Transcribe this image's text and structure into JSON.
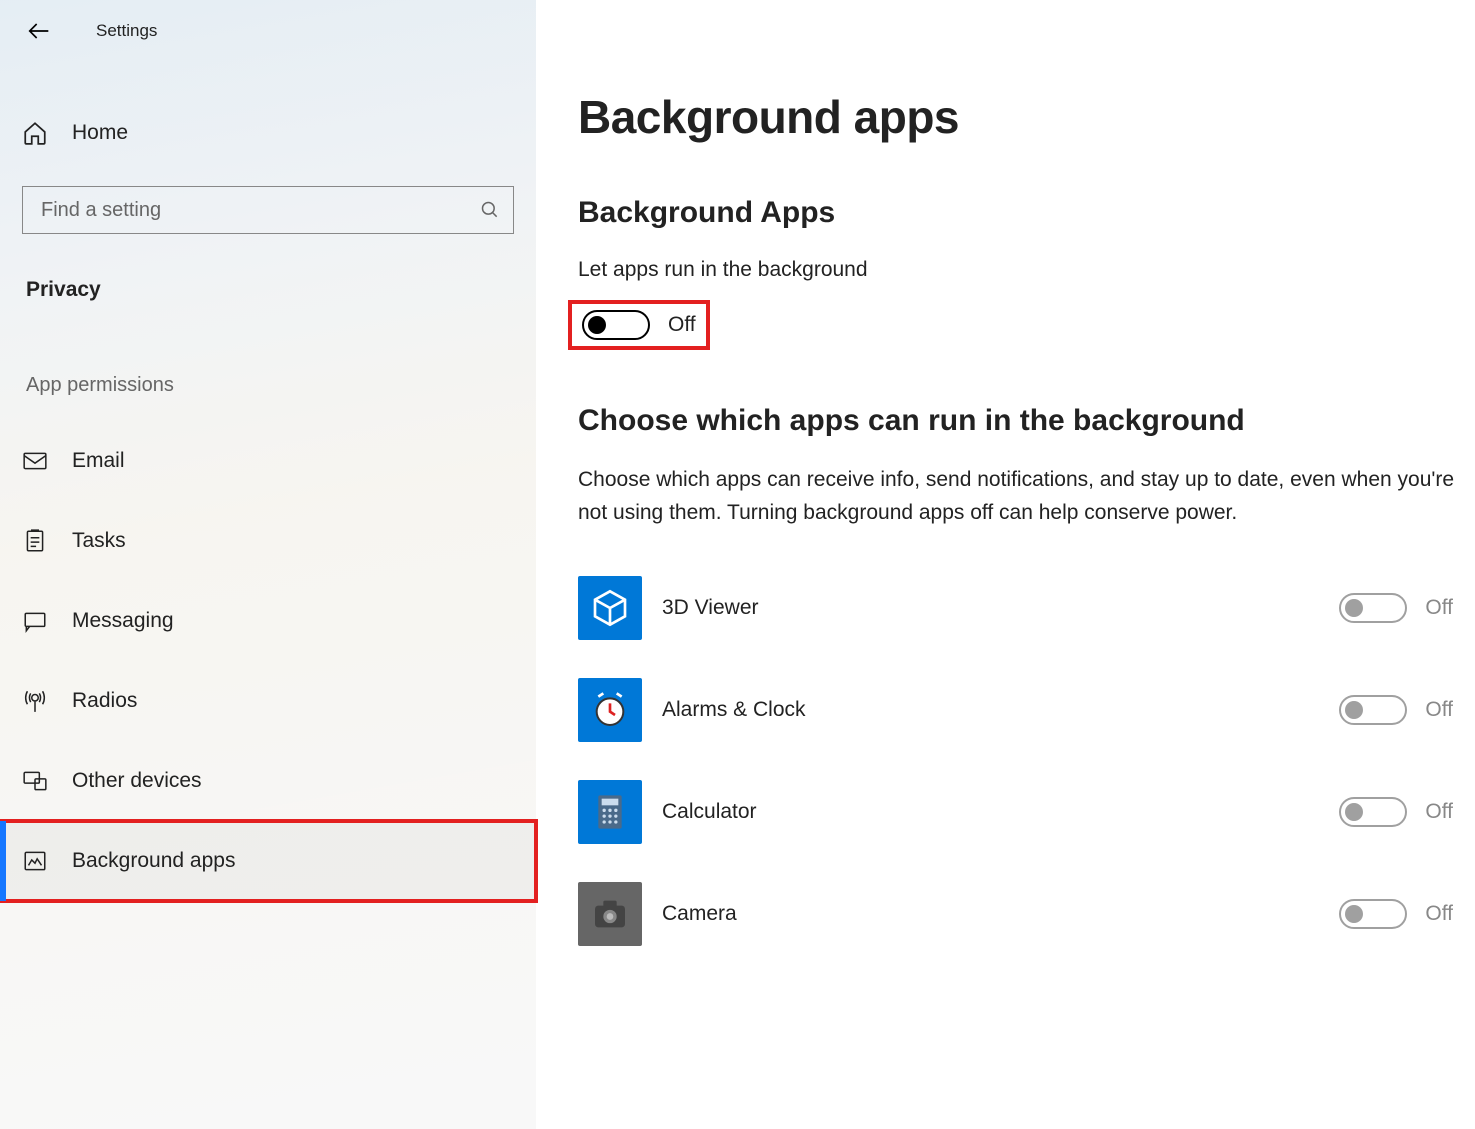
{
  "window": {
    "title": "Settings"
  },
  "sidebar": {
    "home": "Home",
    "search_placeholder": "Find a setting",
    "category": "Privacy",
    "section": "App permissions",
    "items": [
      {
        "key": "email",
        "label": "Email"
      },
      {
        "key": "tasks",
        "label": "Tasks"
      },
      {
        "key": "messaging",
        "label": "Messaging"
      },
      {
        "key": "radios",
        "label": "Radios"
      },
      {
        "key": "other-devices",
        "label": "Other devices"
      },
      {
        "key": "background-apps",
        "label": "Background apps",
        "selected": true,
        "highlighted": true
      }
    ]
  },
  "main": {
    "title": "Background apps",
    "section_heading": "Background Apps",
    "setting_label": "Let apps run in the background",
    "master_toggle": {
      "state": "Off",
      "on": false,
      "highlighted": true
    },
    "choose_heading": "Choose which apps can run in the background",
    "description": "Choose which apps can receive info, send notifications, and stay up to date, even when you're not using them. Turning background apps off can help conserve power.",
    "apps": [
      {
        "name": "3D Viewer",
        "state": "Off",
        "tile": "blue"
      },
      {
        "name": "Alarms & Clock",
        "state": "Off",
        "tile": "blue"
      },
      {
        "name": "Calculator",
        "state": "Off",
        "tile": "blue"
      },
      {
        "name": "Camera",
        "state": "Off",
        "tile": "gray"
      }
    ],
    "colors": {
      "accent": "#0078d7",
      "highlight": "#e32020"
    }
  }
}
